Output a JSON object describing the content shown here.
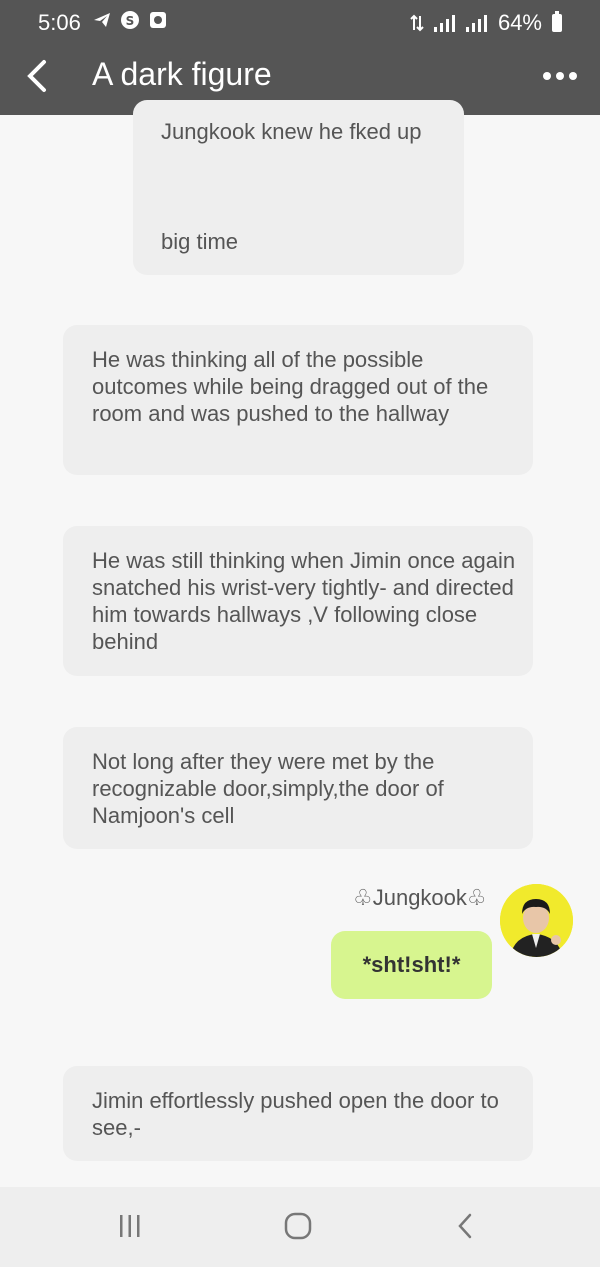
{
  "status_bar": {
    "time": "5:06",
    "battery": "64%",
    "icons": [
      "telegram-icon",
      "s-app-icon",
      "box-app-icon",
      "data-arrows-icon",
      "signal-icon",
      "signal-icon",
      "battery-icon"
    ]
  },
  "header": {
    "title": "A dark figure",
    "back_icon": "chevron-left-icon",
    "more_icon": "more-dots-icon"
  },
  "messages": [
    {
      "type": "narration",
      "lines": [
        "Jungkook knew he fked up",
        "big time"
      ]
    },
    {
      "type": "narration",
      "text": "He was thinking all of the possible outcomes while being dragged out of the room and was pushed to the hallway"
    },
    {
      "type": "narration",
      "text": "He was still thinking when Jimin once again snatched his wrist-very tightly- and directed him towards hallways ,V following close behind"
    },
    {
      "type": "narration",
      "text": "Not long after they were met by the recognizable door,simply,the door of Namjoon's cell"
    },
    {
      "type": "character",
      "speaker": "♧Jungkook♧",
      "text": "*sht!sht!*"
    },
    {
      "type": "narration",
      "text": "Jimin effortlessly pushed open the door to see,-"
    }
  ],
  "nav": {
    "recents_icon": "recents-icon",
    "home_icon": "home-icon",
    "back_icon": "back-icon"
  },
  "colors": {
    "header_bg": "#555555",
    "bubble_bg": "#eeeeee",
    "reply_bg": "#d7f58f",
    "avatar_bg": "#f1ea2c"
  }
}
